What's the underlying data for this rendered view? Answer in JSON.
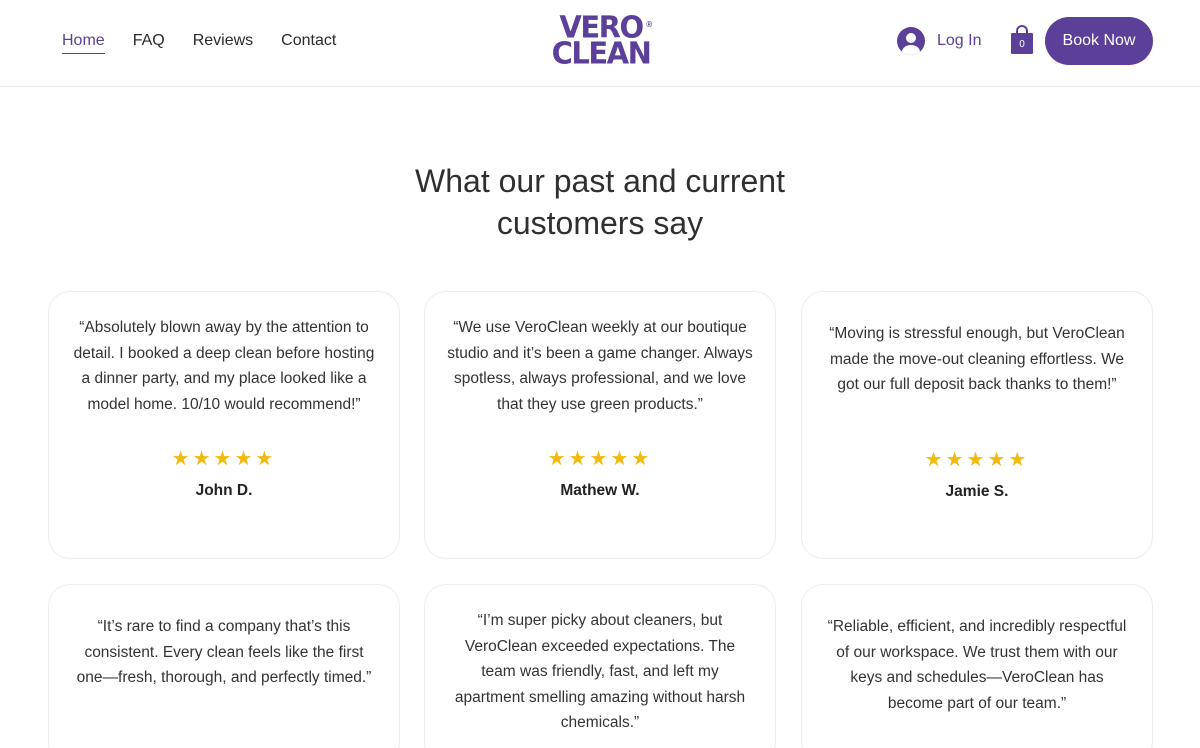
{
  "nav": {
    "items": [
      {
        "label": "Home",
        "active": true
      },
      {
        "label": "FAQ",
        "active": false
      },
      {
        "label": "Reviews",
        "active": false
      },
      {
        "label": "Contact",
        "active": false
      }
    ]
  },
  "logo": {
    "line1": "VERO",
    "line2": "CLEAN",
    "mark": "®"
  },
  "header": {
    "login_label": "Log In",
    "cart_count": "0",
    "book_label": "Book Now"
  },
  "colors": {
    "brand": "#5b3f98",
    "star": "#f2b90f"
  },
  "section": {
    "title_line1": "What our past and current",
    "title_line2": "customers say"
  },
  "reviews": [
    {
      "quote": "“Absolutely blown away by the attention to detail. I booked a deep clean before hosting a dinner party, and my place looked like a model home. 10/10 would recommend!”",
      "stars": "★★★★★",
      "rating": 5,
      "author": "John D."
    },
    {
      "quote": "“We use VeroClean weekly at our boutique studio and it’s been a game changer. Always spotless, always professional, and we love that they use green products.”",
      "stars": "★★★★★",
      "rating": 5,
      "author": "Mathew W."
    },
    {
      "quote": "“Moving is stressful enough, but VeroClean made the move-out cleaning effortless. We got our full deposit back thanks to them!”",
      "stars": "★★★★★",
      "rating": 5,
      "author": "Jamie S."
    },
    {
      "quote": "“It’s rare to find a company that’s this consistent. Every clean feels like the first one—fresh, thorough, and perfectly timed.”"
    },
    {
      "quote": "“I’m super picky about cleaners, but VeroClean exceeded expectations. The team was friendly, fast, and left my apartment smelling amazing without harsh chemicals.”"
    },
    {
      "quote": "“Reliable, efficient, and incredibly respectful of our workspace. We trust them with our keys and schedules—VeroClean has become part of our team.”"
    }
  ]
}
